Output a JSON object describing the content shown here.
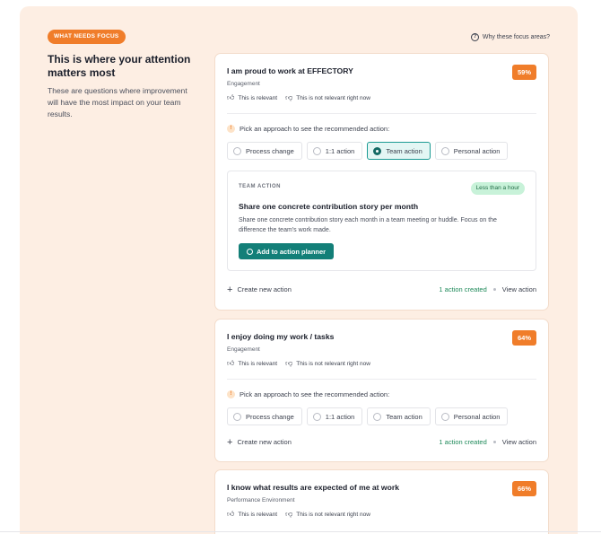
{
  "header": {
    "badge": "WHAT NEEDS FOCUS",
    "why_link": "Why these focus areas?",
    "why_icon": "help-circle-icon"
  },
  "intro": {
    "title": "This is where your attention matters most",
    "text": "These are questions where improvement will have the most impact on your team results."
  },
  "common": {
    "relevant": "This is relevant",
    "not_relevant": "This is not relevant right now",
    "pick_prompt": "Pick an approach to see the recommended action:",
    "options": [
      "Process change",
      "1:1 action",
      "Team action",
      "Personal action"
    ],
    "create_action": "Create new action",
    "actions_created": "1 action created",
    "view_action": "View action"
  },
  "cards": [
    {
      "title": "I am proud to work at EFFECTORY",
      "category": "Engagement",
      "score": "59%",
      "selected_option": "Team action",
      "action": {
        "type": "TEAM ACTION",
        "duration": "Less than a hour",
        "title": "Share one concrete contribution story per month",
        "description": "Share one concrete contribution story each month in a team meeting or huddle. Focus on the difference the team's work made.",
        "button": "Add to action planner"
      }
    },
    {
      "title": "I enjoy doing my work / tasks",
      "category": "Engagement",
      "score": "64%"
    },
    {
      "title": "I know what results are expected of me at work",
      "category": "Performance Environment",
      "score": "66%"
    }
  ],
  "colors": {
    "accent_orange": "#f07d2a",
    "teal": "#137f78",
    "panel_bg": "#fdeee3"
  }
}
